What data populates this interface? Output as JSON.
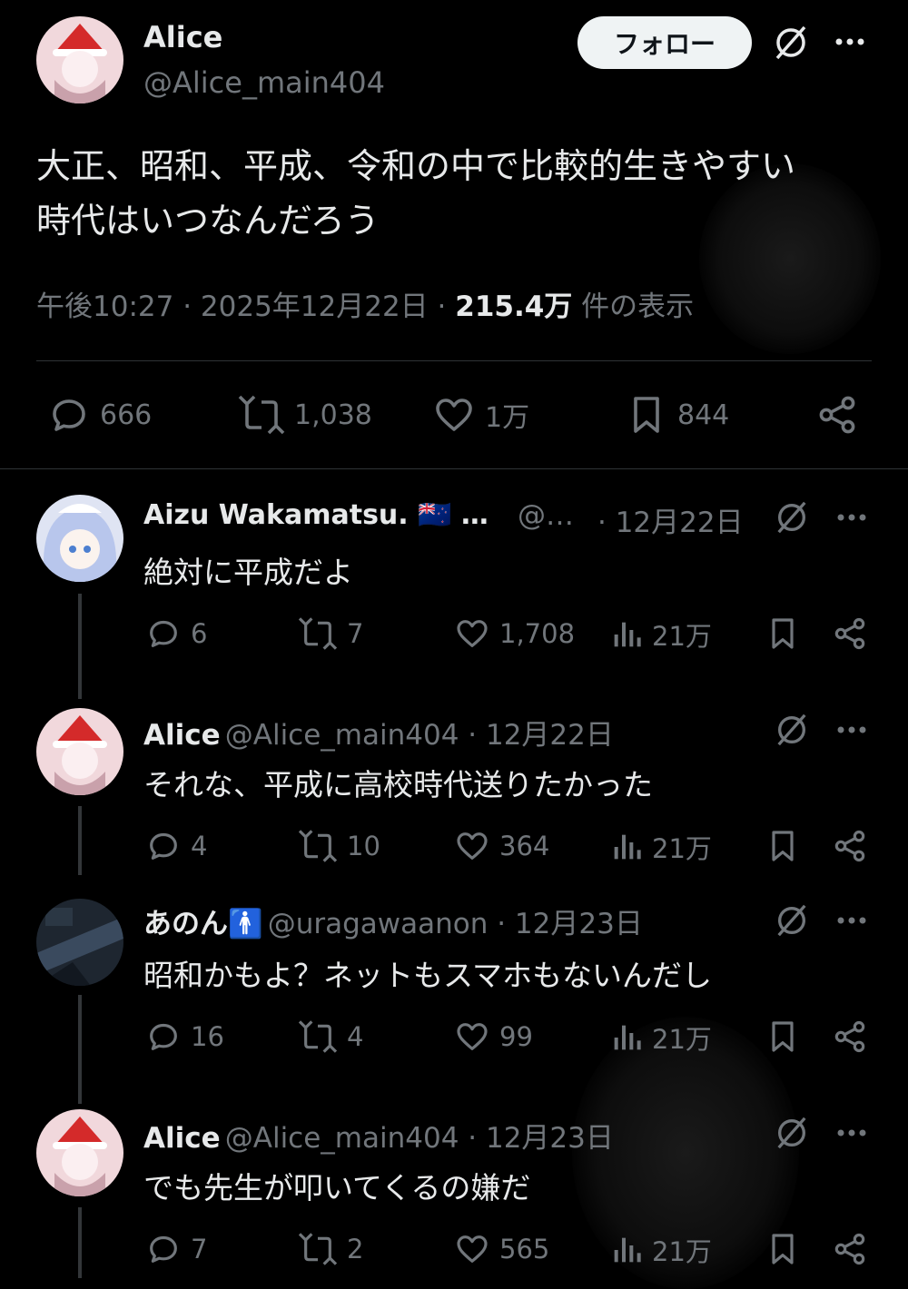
{
  "main_post": {
    "display_name": "Alice",
    "handle": "@Alice_main404",
    "follow_label": "フォロー",
    "text_line1": "大正、昭和、平成、令和の中で比較的生きやすい",
    "text_line2": "時代はいつなんだろう",
    "time": "午後10:27 · 2025年12月22日 · ",
    "views_count": "215.4万",
    "views_suffix": " 件の表示",
    "replies": "666",
    "reposts": "1,038",
    "likes": "1万",
    "bookmarks": "844"
  },
  "replies": [
    {
      "display_name": "Aizu Wakamatsu. 🇳🇿 …",
      "handle": "@…",
      "date": "· 12月22日",
      "text": "絶対に平成だよ",
      "replies": "6",
      "reposts": "7",
      "likes": "1,708",
      "views": "21万"
    },
    {
      "display_name": "Alice",
      "handle": "@Alice_main404 · 12月22日",
      "text": "それな、平成に高校時代送りたかった",
      "replies": "4",
      "reposts": "10",
      "likes": "364",
      "views": "21万"
    },
    {
      "display_name": "あのん🚹",
      "handle": "@uragawaanon · 12月23日",
      "text": "昭和かもよ？ネットもスマホもないんだし",
      "replies": "16",
      "reposts": "4",
      "likes": "99",
      "views": "21万"
    },
    {
      "display_name": "Alice",
      "handle": "@Alice_main404 · 12月23日",
      "text": "でも先生が叩いてくるの嫌だ",
      "replies": "7",
      "reposts": "2",
      "likes": "565",
      "views": "21万"
    }
  ],
  "icons": {
    "reply": "reply-icon",
    "repost": "repost-icon",
    "like": "like-icon",
    "bookmark": "bookmark-icon",
    "share": "share-icon",
    "views": "views-icon",
    "grok": "grok-icon",
    "more": "more-icon"
  },
  "colors": {
    "background": "#000000",
    "text": "#e7e9ea",
    "muted": "#71767b",
    "follow_bg": "#eff3f4"
  }
}
